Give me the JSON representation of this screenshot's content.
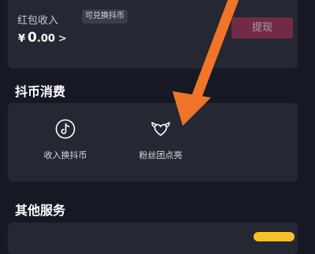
{
  "wallet": {
    "income_label": "红包收入",
    "badge": "可兑换抖币",
    "currency_symbol": "¥",
    "amount_int": "0",
    "amount_dec": ".00",
    "amount_arrow": ">",
    "withdraw_label": "提现"
  },
  "coin_spending": {
    "title": "抖币消费",
    "items": [
      {
        "label": "收入换抖币",
        "icon": "tiktok-note-icon"
      },
      {
        "label": "粉丝团点亮",
        "icon": "heart-wings-icon"
      }
    ]
  },
  "other_services": {
    "title": "其他服务"
  },
  "colors": {
    "background": "#161823",
    "card": "#252733",
    "withdraw_bg": "#732a44",
    "arrow": "#f07528",
    "tag": "#f6c12a"
  }
}
